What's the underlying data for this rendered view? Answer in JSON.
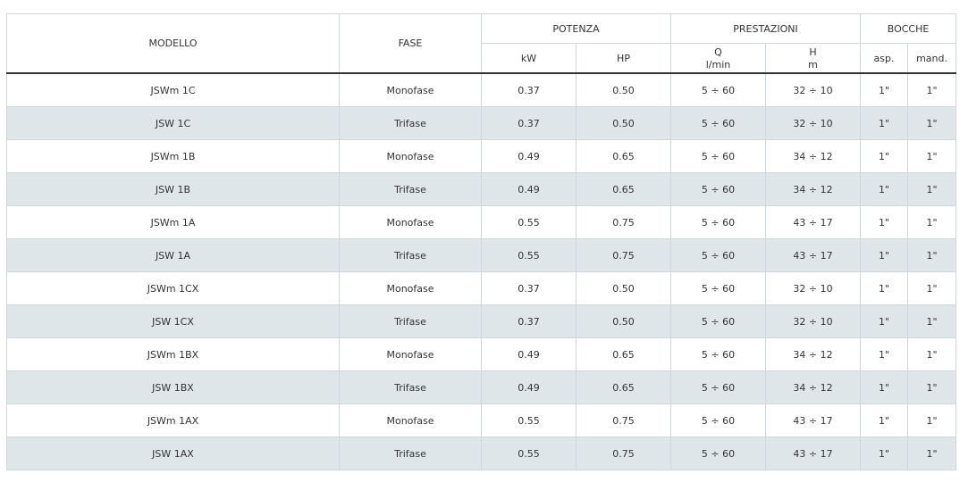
{
  "header": {
    "modello": "MODELLO",
    "fase": "FASE",
    "potenza": "POTENZA",
    "prestazioni": "PRESTAZIONI",
    "bocche": "BOCCHE",
    "kw": "kW",
    "hp": "HP",
    "q": "Q",
    "q_unit": "l/min",
    "h": "H",
    "h_unit": "m",
    "asp": "asp.",
    "mand": "mand."
  },
  "rows": [
    {
      "modello": "JSWm 1C",
      "fase": "Monofase",
      "kw": "0.37",
      "hp": "0.50",
      "q": "5 ÷ 60",
      "h": "32 ÷ 10",
      "asp": "1\"",
      "mand": "1\""
    },
    {
      "modello": "JSW 1C",
      "fase": "Trifase",
      "kw": "0.37",
      "hp": "0.50",
      "q": "5 ÷ 60",
      "h": "32 ÷ 10",
      "asp": "1\"",
      "mand": "1\""
    },
    {
      "modello": "JSWm 1B",
      "fase": "Monofase",
      "kw": "0.49",
      "hp": "0.65",
      "q": "5 ÷ 60",
      "h": "34 ÷ 12",
      "asp": "1\"",
      "mand": "1\""
    },
    {
      "modello": "JSW 1B",
      "fase": "Trifase",
      "kw": "0.49",
      "hp": "0.65",
      "q": "5 ÷ 60",
      "h": "34 ÷ 12",
      "asp": "1\"",
      "mand": "1\""
    },
    {
      "modello": "JSWm 1A",
      "fase": "Monofase",
      "kw": "0.55",
      "hp": "0.75",
      "q": "5 ÷ 60",
      "h": "43 ÷ 17",
      "asp": "1\"",
      "mand": "1\""
    },
    {
      "modello": "JSW 1A",
      "fase": "Trifase",
      "kw": "0.55",
      "hp": "0.75",
      "q": "5 ÷ 60",
      "h": "43 ÷ 17",
      "asp": "1\"",
      "mand": "1\""
    },
    {
      "modello": "JSWm 1CX",
      "fase": "Monofase",
      "kw": "0.37",
      "hp": "0.50",
      "q": "5 ÷ 60",
      "h": "32 ÷ 10",
      "asp": "1\"",
      "mand": "1\""
    },
    {
      "modello": "JSW 1CX",
      "fase": "Trifase",
      "kw": "0.37",
      "hp": "0.50",
      "q": "5 ÷ 60",
      "h": "32 ÷ 10",
      "asp": "1\"",
      "mand": "1\""
    },
    {
      "modello": "JSWm 1BX",
      "fase": "Monofase",
      "kw": "0.49",
      "hp": "0.65",
      "q": "5 ÷ 60",
      "h": "34 ÷ 12",
      "asp": "1\"",
      "mand": "1\""
    },
    {
      "modello": "JSW 1BX",
      "fase": "Trifase",
      "kw": "0.49",
      "hp": "0.65",
      "q": "5 ÷ 60",
      "h": "34 ÷ 12",
      "asp": "1\"",
      "mand": "1\""
    },
    {
      "modello": "JSWm 1AX",
      "fase": "Monofase",
      "kw": "0.55",
      "hp": "0.75",
      "q": "5 ÷ 60",
      "h": "43 ÷ 17",
      "asp": "1\"",
      "mand": "1\""
    },
    {
      "modello": "JSW 1AX",
      "fase": "Trifase",
      "kw": "0.55",
      "hp": "0.75",
      "q": "5 ÷ 60",
      "h": "43 ÷ 17",
      "asp": "1\"",
      "mand": "1\""
    }
  ]
}
